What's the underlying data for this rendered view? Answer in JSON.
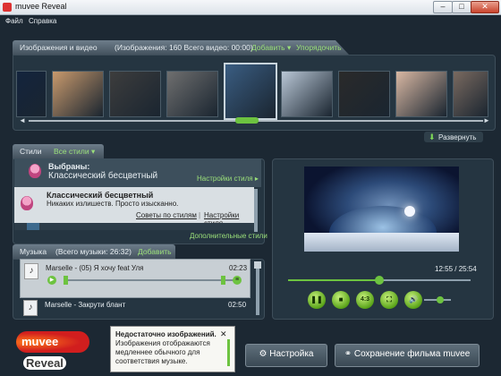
{
  "window": {
    "title": "muvee Reveal",
    "controls": {
      "minimize": "–",
      "maximize": "□",
      "close": "✕"
    }
  },
  "menu": {
    "file": "Файл",
    "help": "Справка"
  },
  "gallery": {
    "header": "Изображения и видео",
    "summary": "(Изображения: 160   Всего видео: 00:00)",
    "add": "Добавить",
    "arrange": "Упорядочить",
    "expand": "Развернуть",
    "thumb_colors": [
      "#13243d",
      "#c99a6d",
      "#3d3d3d",
      "#6f6f6f",
      "#3a5d82",
      "#b9c7d6",
      "#2a2a2a",
      "#d9b8a3",
      "#7a6a60"
    ],
    "selected_index": 4,
    "scroll_position": 0.5
  },
  "styles": {
    "header": "Стили",
    "filter": "Все стили",
    "selected_label": "Выбраны:",
    "selected_name": "Классический бесцветный",
    "settings_link": "Настройки стиля",
    "item_title": "Классический бесцветный",
    "item_desc": "Никаких излишеств. Просто изысканно.",
    "tips_link": "Советы по стилям",
    "item_settings_link": "Настройки стиля",
    "more_styles": "Дополнительные стили"
  },
  "music": {
    "header": "Музыка",
    "total": "(Всего музыки: 26:32)",
    "add": "Добавить",
    "tracks": [
      {
        "title": "Marselle - (05) Я хочу feat Уля",
        "duration": "02:23"
      },
      {
        "title": "Marselle - Закрути блант",
        "duration": "02:50"
      }
    ]
  },
  "preview": {
    "time": "12:55 / 25:54",
    "seek_fraction": 0.5,
    "volume_fraction": 0.6,
    "aspect_label": "4:3"
  },
  "notice": {
    "title": "Недостаточно изображений.",
    "body": "Изображения отображаются медленнее обычного для соответствия музыке.",
    "close": "✕"
  },
  "buttons": {
    "settings": "Настройка",
    "save": "Сохранение фильма muvee"
  },
  "logo": {
    "brand": "muvee",
    "product": "Reveal"
  }
}
